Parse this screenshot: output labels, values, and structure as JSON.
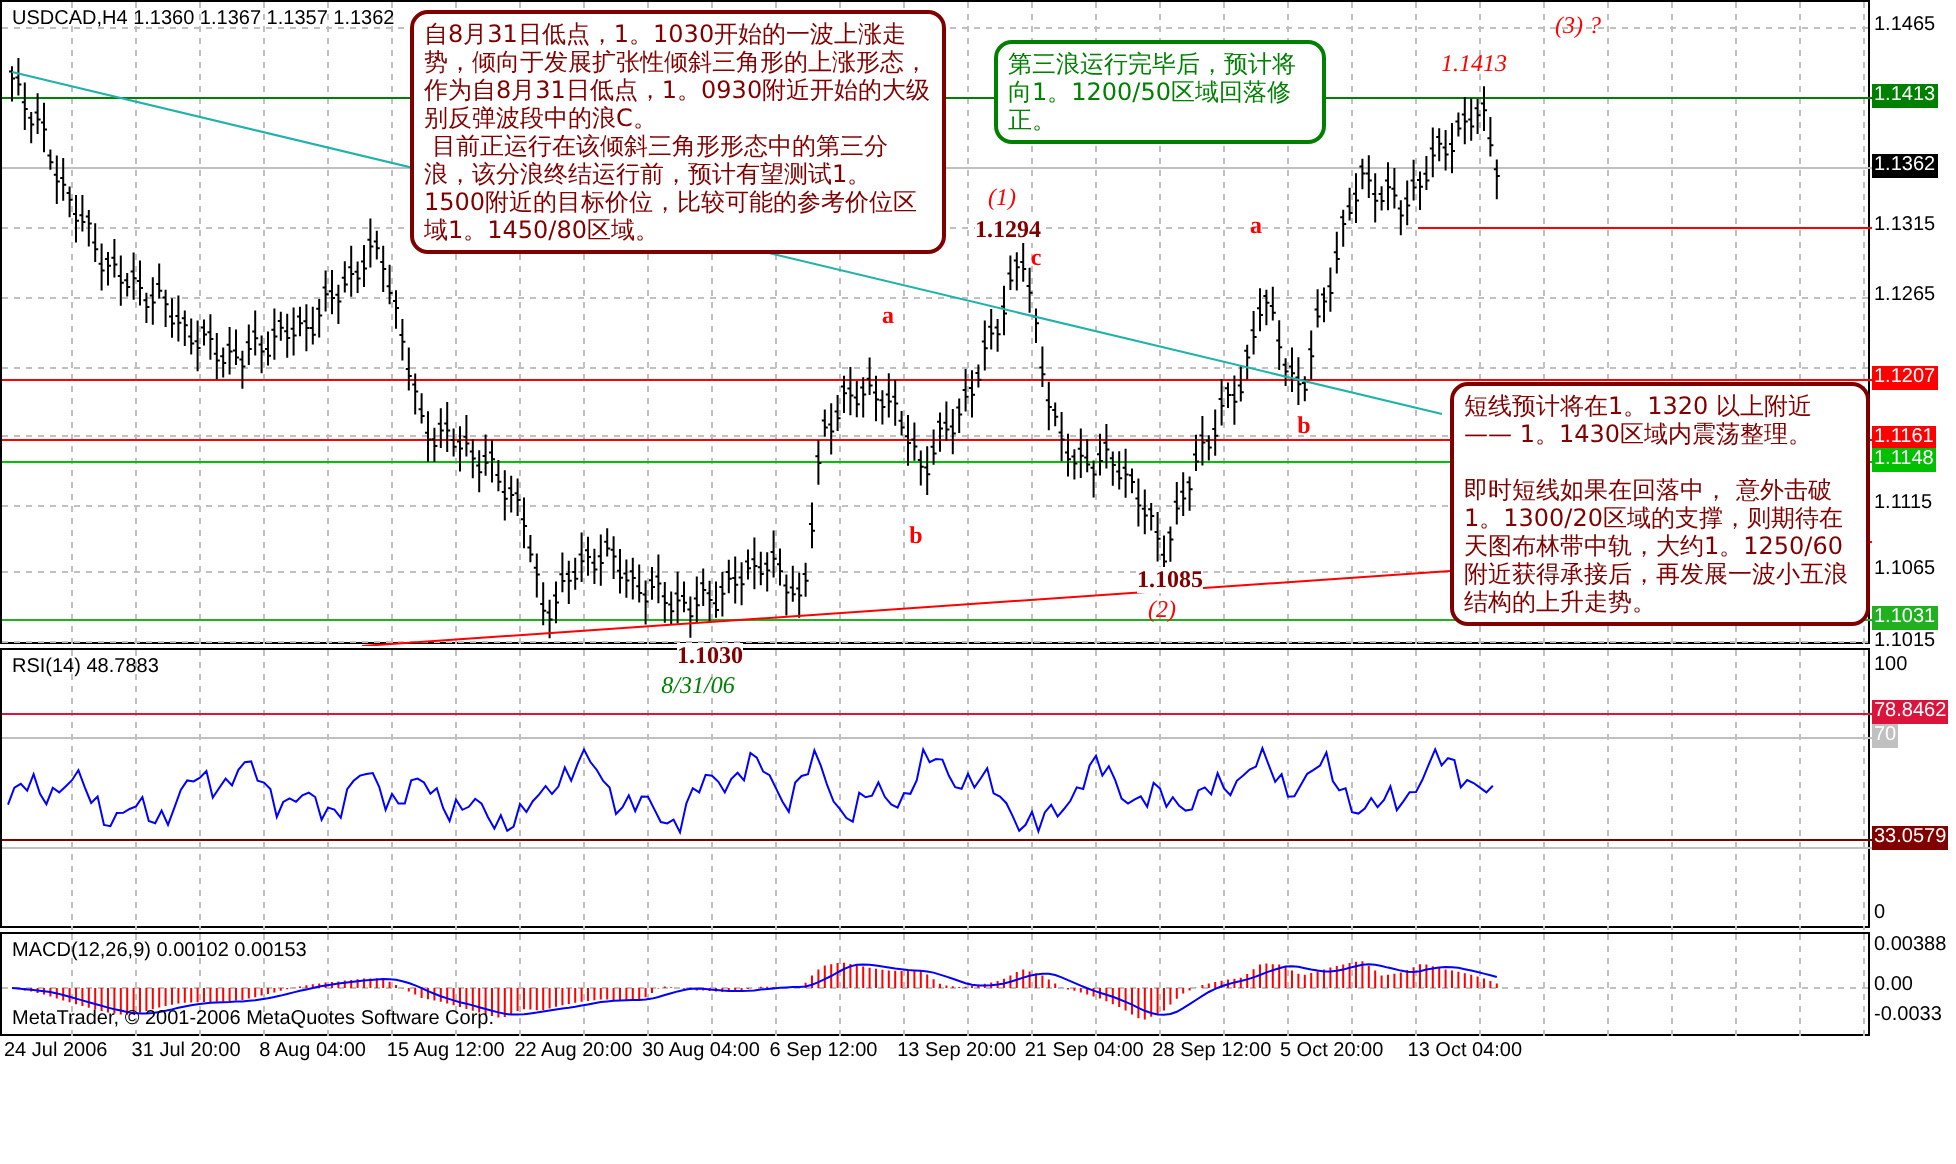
{
  "price_pane": {
    "header": "USDCAD,H4  1.1360 1.1367 1.1357 1.1362",
    "axis_labels": [
      {
        "text": "1.1465",
        "kind": "tick"
      },
      {
        "text": "1.1413",
        "kind": "marker",
        "color": "#008000"
      },
      {
        "text": "1.1362",
        "kind": "marker",
        "color": "#000000"
      },
      {
        "text": "1.1315",
        "kind": "tick"
      },
      {
        "text": "1.1265",
        "kind": "tick"
      },
      {
        "text": "1.1207",
        "kind": "marker",
        "color": "#ff0000"
      },
      {
        "text": "1.1161",
        "kind": "marker",
        "color": "#ff0000"
      },
      {
        "text": "1.1148",
        "kind": "marker",
        "color": "#00c000"
      },
      {
        "text": "1.1115",
        "kind": "tick"
      },
      {
        "text": "1.1065",
        "kind": "tick"
      },
      {
        "text": "1.1031",
        "kind": "marker",
        "color": "#20b020"
      },
      {
        "text": "1.1015",
        "kind": "tick"
      }
    ],
    "annotations": [
      {
        "text": "(3)  ?",
        "kind": "wave"
      },
      {
        "text": "1.1413",
        "kind": "wave"
      },
      {
        "text": "(1)",
        "kind": "wave"
      },
      {
        "text": "1.1294",
        "kind": "price"
      },
      {
        "text": "c",
        "kind": "letter"
      },
      {
        "text": "a",
        "kind": "letter"
      },
      {
        "text": "a",
        "kind": "letter"
      },
      {
        "text": "b",
        "kind": "letter"
      },
      {
        "text": "b",
        "kind": "letter"
      },
      {
        "text": "1.1085",
        "kind": "price"
      },
      {
        "text": "(2)",
        "kind": "wave"
      },
      {
        "text": "1.1030",
        "kind": "price"
      },
      {
        "text": "8/31/06",
        "kind": "date"
      }
    ],
    "notes": [
      {
        "color": "#800000",
        "paragraphs": [
          "自8月31日低点，1。1030开始的一波上涨走势，倾向于发展扩张性倾斜三角形的上涨形态，作为自8月31日低点，1。0930附近开始的大级别反弹波段中的浪C。",
          " 目前正运行在该倾斜三角形形态中的第三分浪，该分浪终结运行前，预计有望测试1。1500附近的目标价位，比较可能的参考价位区域1。1450/80区域。"
        ]
      },
      {
        "color": "#008000",
        "paragraphs": [
          "第三浪运行完毕后，预计将向1。1200/50区域回落修正。"
        ]
      },
      {
        "color": "#800000",
        "paragraphs": [
          "短线预计将在1。1320 以上附近 —— 1。1430区域内震荡整理。",
          "即时短线如果在回落中， 意外击破1。1300/20区域的支撑，则期待在天图布林带中轨，大约1。1250/60附近获得承接后，再发展一波小五浪结构的上升走势。"
        ]
      }
    ]
  },
  "rsi_pane": {
    "header": "RSI(14) 48.7883",
    "axis_labels": [
      {
        "text": "100",
        "kind": "tick"
      },
      {
        "text": "78.8462",
        "kind": "marker",
        "color": "#dc143c"
      },
      {
        "text": "70",
        "kind": "marker",
        "color": "#c0c0c0"
      },
      {
        "text": "33.0579",
        "kind": "marker",
        "color": "#800000"
      },
      {
        "text": "0",
        "kind": "tick"
      }
    ]
  },
  "macd_pane": {
    "header": "MACD(12,26,9) 0.00102 0.00153",
    "footer": "MetaTrader, © 2001-2006 MetaQuotes Software Corp.",
    "axis_labels": [
      {
        "text": "0.00388",
        "kind": "tick"
      },
      {
        "text": "0.00",
        "kind": "tick"
      },
      {
        "text": "-0.0033",
        "kind": "tick"
      }
    ]
  },
  "time_axis": [
    "24 Jul 2006",
    "31 Jul 20:00",
    "8 Aug 04:00",
    "15 Aug 12:00",
    "22 Aug 20:00",
    "30 Aug 04:00",
    "6 Sep 12:00",
    "13 Sep 20:00",
    "21 Sep 04:00",
    "28 Sep 12:00",
    "5 Oct 20:00",
    "13 Oct 04:00"
  ]
}
